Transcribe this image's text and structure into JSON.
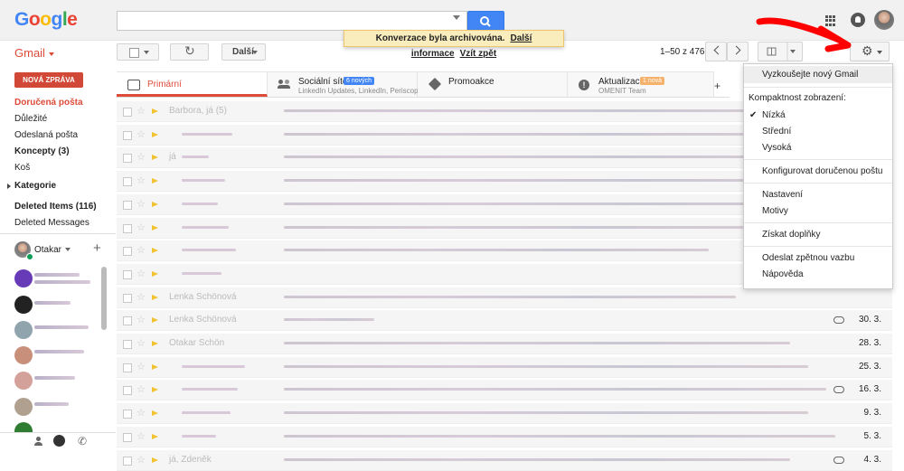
{
  "header": {
    "logo": [
      "G",
      "o",
      "o",
      "g",
      "l",
      "e"
    ],
    "app_label": "Gmail"
  },
  "toolbar": {
    "more_label": "Další",
    "pager": "1–50 z 476"
  },
  "toast": {
    "message": "Konverzace byla archivována.",
    "link_more": "Další informace",
    "link_undo": "Vzít zpět"
  },
  "sidebar": {
    "compose": "NOVÁ ZPRÁVA",
    "items": [
      {
        "label": "Doručená pošta",
        "style": "active"
      },
      {
        "label": "Důležité",
        "style": ""
      },
      {
        "label": "Odeslaná pošta",
        "style": ""
      },
      {
        "label": "Koncepty (3)",
        "style": "bold"
      },
      {
        "label": "Koš",
        "style": ""
      },
      {
        "label": "Kategorie",
        "style": "bold"
      },
      {
        "label": "Deleted Items (116)",
        "style": "bold"
      },
      {
        "label": "Deleted Messages",
        "style": ""
      }
    ],
    "hangouts_user": "Otakar",
    "contact_colors": [
      "#673ab7",
      "#222222",
      "#90a4ae",
      "#c8907a",
      "#d4a09a",
      "#b0a090",
      "#2e7d32"
    ]
  },
  "tabs": [
    {
      "label": "Primární",
      "sub": "",
      "badge": "",
      "icon": "inbox-icon"
    },
    {
      "label": "Sociální sítě",
      "sub": "LinkedIn Updates, LinkedIn, Periscop...",
      "badge": "6 nových",
      "badge_color": "#4285f4",
      "icon": "people-icon"
    },
    {
      "label": "Promoakce",
      "sub": "",
      "badge": "",
      "icon": "tag-icon"
    },
    {
      "label": "Aktualizace",
      "sub": "OMENIT Team",
      "badge": "1 nová",
      "badge_color": "#f6b26b",
      "icon": "info-icon"
    }
  ],
  "rows": [
    {
      "sender": "Barbora, já (5)",
      "snippet": "",
      "date": "",
      "clip": false
    },
    {
      "sender": "",
      "snippet": "",
      "date": "",
      "clip": false
    },
    {
      "sender": "já",
      "snippet": "",
      "date": "",
      "clip": false
    },
    {
      "sender": "",
      "snippet": "",
      "date": "",
      "clip": false
    },
    {
      "sender": "",
      "snippet": "",
      "date": "",
      "clip": false
    },
    {
      "sender": "",
      "snippet": "",
      "date": "",
      "clip": false
    },
    {
      "sender": "",
      "snippet": "",
      "date": "",
      "clip": false
    },
    {
      "sender": "",
      "snippet": "",
      "date": "",
      "clip": false
    },
    {
      "sender": "Lenka Schönová",
      "snippet": "",
      "date": "",
      "clip": false
    },
    {
      "sender": "Lenka Schönová",
      "snippet": "",
      "date": "30. 3.",
      "clip": true
    },
    {
      "sender": "Otakar Schön",
      "snippet": "",
      "date": "28. 3.",
      "clip": false
    },
    {
      "sender": "",
      "snippet": "",
      "date": "25. 3.",
      "clip": false
    },
    {
      "sender": "",
      "snippet": "",
      "date": "16. 3.",
      "clip": true
    },
    {
      "sender": "",
      "snippet": "",
      "date": "9. 3.",
      "clip": false
    },
    {
      "sender": "",
      "snippet": "",
      "date": "5. 3.",
      "clip": false
    },
    {
      "sender": "já, Zdeněk",
      "snippet": "",
      "date": "4. 3.",
      "clip": true
    }
  ],
  "gear_menu": {
    "try_new": "Vyzkoušejte nový Gmail",
    "density_heading": "Kompaktnost zobrazení:",
    "density_options": [
      "Nízká",
      "Střední",
      "Vysoká"
    ],
    "configure_inbox": "Konfigurovat doručenou poštu",
    "settings": "Nastavení",
    "themes": "Motivy",
    "addons": "Získat doplňky",
    "feedback": "Odeslat zpětnou vazbu",
    "help": "Nápověda"
  },
  "colors": {
    "accent_red": "#dd4b39",
    "search_blue": "#4285f4",
    "annotation_red": "#ff0000"
  }
}
